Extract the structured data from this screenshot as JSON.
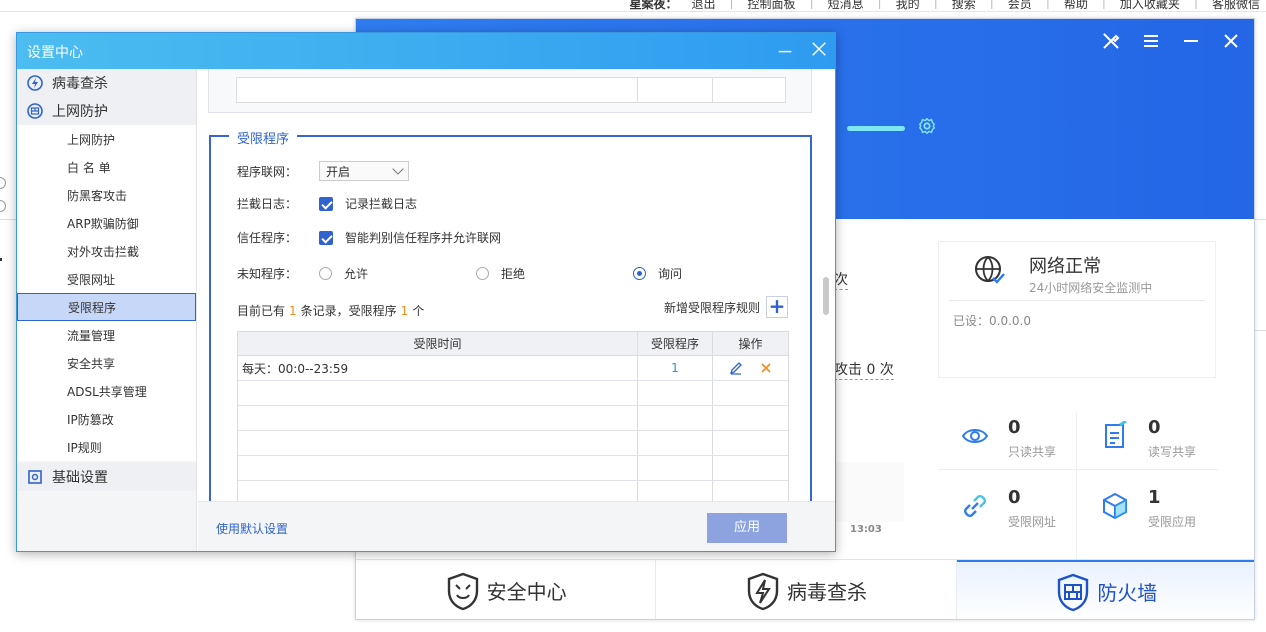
{
  "bg_page": {
    "top_links": [
      "星案夜：",
      "退出",
      "控制面板",
      "短消息",
      "我的",
      "搜索",
      "会员",
      "帮助",
      "加入收藏夹",
      "客服微信"
    ]
  },
  "main_app": {
    "frag_times": "次",
    "frag_attack": "攻击 0 次",
    "frag_time": "13:03",
    "net_status": {
      "title": "网络正常",
      "subtitle": "24小时网络安全监测中",
      "ip": "已设：0.0.0.0"
    },
    "stats": [
      {
        "num": "0",
        "label": "只读共享",
        "icon": "eye-icon"
      },
      {
        "num": "0",
        "label": "读写共享",
        "icon": "document-edit-icon"
      },
      {
        "num": "0",
        "label": "受限网址",
        "icon": "link-icon"
      },
      {
        "num": "1",
        "label": "受限应用",
        "icon": "cube-icon"
      }
    ],
    "tabs": [
      {
        "label": "安全中心",
        "icon": "lion-shield-icon"
      },
      {
        "label": "病毒查杀",
        "icon": "lightning-shield-icon"
      },
      {
        "label": "防火墙",
        "icon": "firewall-shield-icon"
      }
    ],
    "colors": {
      "accent": "#2f7cf0",
      "banner_bar": "#7fe7f4"
    }
  },
  "dialog": {
    "title": "设置中心",
    "sidebar": {
      "group_virus": "病毒查杀",
      "group_web": "上网防护",
      "items": [
        "上网防护",
        "白 名 单",
        "防黑客攻击",
        "ARP欺骗防御",
        "对外攻击拦截",
        "受限网址",
        "受限程序",
        "流量管理",
        "安全共享",
        "ADSL共享管理",
        "IP防篡改",
        "IP规则"
      ],
      "active_index": 6,
      "group_basic": "基础设置"
    },
    "section": {
      "legend": "受限程序",
      "net_label": "程序联网：",
      "net_value": "开启",
      "log_label": "拦截日志：",
      "log_text": "记录拦截日志",
      "trust_label": "信任程序：",
      "trust_text": "智能判别信任程序并允许联网",
      "unknown_label": "未知程序：",
      "radio_allow": "允许",
      "radio_deny": "拒绝",
      "radio_ask": "询问",
      "summary_prefix": "目前已有",
      "summary_count": "1",
      "summary_mid": "条记录，受限程序",
      "summary_prog": "1",
      "summary_suffix": "个",
      "add_rule": "新增受限程序规则"
    },
    "table": {
      "headers": [
        "受限时间",
        "受限程序",
        "操作"
      ],
      "rows": [
        {
          "time": "每天：00:0--23:59",
          "prog": "1"
        }
      ]
    },
    "footer": {
      "reset": "使用默认设置",
      "apply": "应用"
    }
  }
}
